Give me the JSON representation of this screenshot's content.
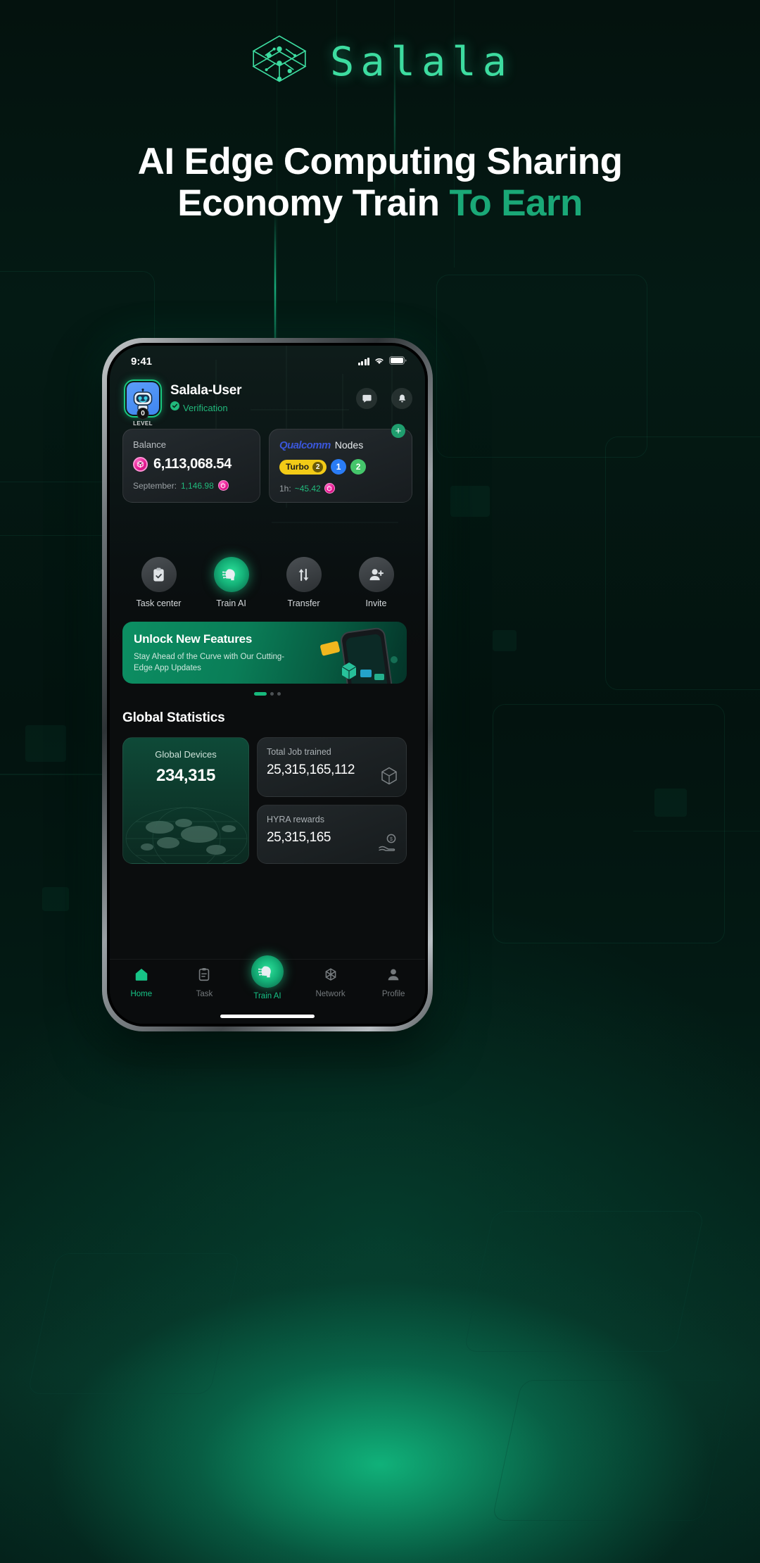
{
  "brand": {
    "name": "Salala",
    "logo_icon": "cube-network-icon",
    "color": "#3ddca0"
  },
  "headline": {
    "line1": "AI Edge Computing Sharing",
    "line2_white": "Economy Train",
    "line2_accent": "To Earn",
    "accent_color": "#1aa877"
  },
  "phone": {
    "statusbar": {
      "time": "9:41",
      "signal_icon": "cellular-bars-icon",
      "wifi_icon": "wifi-icon",
      "battery_icon": "battery-full-icon"
    },
    "header": {
      "avatar_icon": "robot-avatar-icon",
      "level_value": "0",
      "level_label": "LEVEL",
      "user_name": "Salala-User",
      "verification_label": "Verification",
      "verified_icon": "check-circle-icon",
      "verification_color": "#21b97c",
      "message_icon": "message-icon",
      "bell_icon": "bell-icon"
    },
    "balance_card": {
      "label": "Balance",
      "token_icon": "hyra-token-icon",
      "value": "6,113,068.54",
      "sub_label": "September:",
      "sub_value": "1,146.98",
      "sub_token_icon": "hyra-token-icon",
      "sub_color": "#21b97c"
    },
    "nodes_card": {
      "brand": "Qualcomm",
      "title_suffix": "Nodes",
      "brand_color": "#3a56d8",
      "add_button_label": "+",
      "pills": [
        {
          "label": "Turbo",
          "count": "2",
          "style": "turbo"
        },
        {
          "label": "1",
          "style": "blue"
        },
        {
          "label": "2",
          "style": "green"
        }
      ],
      "sub_label": "1h:",
      "sub_value": "~45.42",
      "sub_token_icon": "hyra-token-icon",
      "sub_color": "#21b97c"
    },
    "actions": [
      {
        "label": "Task center",
        "icon": "clipboard-check-icon",
        "active": false
      },
      {
        "label": "Train AI",
        "icon": "ai-head-icon",
        "active": true
      },
      {
        "label": "Transfer",
        "icon": "transfer-arrows-icon",
        "active": false
      },
      {
        "label": "Invite",
        "icon": "user-plus-icon",
        "active": false
      }
    ],
    "banner": {
      "title": "Unlock New Features",
      "subtitle": "Stay Ahead of the Curve with Our Cutting-Edge App Updates",
      "art_icon": "phone-mockup-icon",
      "dots": 3,
      "active_dot": 0
    },
    "global_statistics": {
      "title": "Global Statistics",
      "devices": {
        "label": "Global Devices",
        "value": "234,315",
        "art_icon": "globe-map-icon"
      },
      "cards": [
        {
          "label": "Total Job trained",
          "value": "25,315,165,112",
          "icon": "cube-3d-icon"
        },
        {
          "label": "HYRA rewards",
          "value": "25,315,165",
          "icon": "hand-coin-icon"
        }
      ]
    },
    "tabbar": [
      {
        "label": "Home",
        "icon": "home-icon",
        "active": true,
        "center": false
      },
      {
        "label": "Task",
        "icon": "clipboard-icon",
        "active": false,
        "center": false
      },
      {
        "label": "Train AI",
        "icon": "ai-head-icon",
        "active": true,
        "center": true
      },
      {
        "label": "Network",
        "icon": "network-atom-icon",
        "active": false,
        "center": false
      },
      {
        "label": "Profile",
        "icon": "person-icon",
        "active": false,
        "center": false
      }
    ]
  }
}
